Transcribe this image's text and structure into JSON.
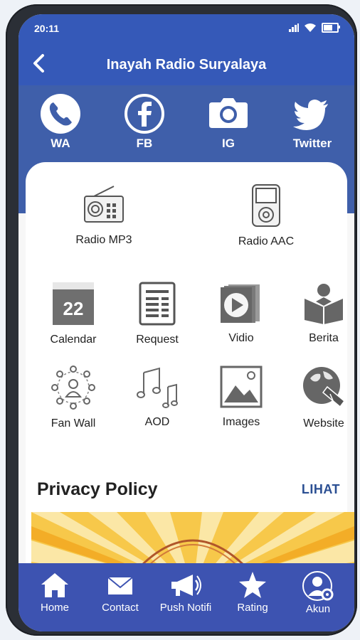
{
  "status": {
    "time": "20:11"
  },
  "app": {
    "title": "Inayah Radio Suryalaya"
  },
  "social": [
    {
      "label": "WA",
      "icon": "phone-icon"
    },
    {
      "label": "FB",
      "icon": "facebook-icon"
    },
    {
      "label": "IG",
      "icon": "camera-icon"
    },
    {
      "label": "Twitter",
      "icon": "twitter-icon"
    }
  ],
  "radios": [
    {
      "label": "Radio MP3",
      "icon": "radio-icon"
    },
    {
      "label": "Radio AAC",
      "icon": "ipod-icon"
    }
  ],
  "menu": [
    {
      "label": "Calendar",
      "icon": "calendar-icon",
      "badge": "22"
    },
    {
      "label": "Request",
      "icon": "document-icon"
    },
    {
      "label": "Vidio",
      "icon": "video-icon"
    },
    {
      "label": "Berita",
      "icon": "reader-icon"
    },
    {
      "label": "Fan Wall",
      "icon": "network-icon"
    },
    {
      "label": "AOD",
      "icon": "music-icon"
    },
    {
      "label": "Images",
      "icon": "image-icon"
    },
    {
      "label": "Website",
      "icon": "globe-hand-icon"
    }
  ],
  "privacy": {
    "title": "Privacy Policy",
    "link": "LIHAT"
  },
  "nav": [
    {
      "label": "Home",
      "icon": "home-icon"
    },
    {
      "label": "Contact",
      "icon": "mail-icon"
    },
    {
      "label": "Push Notifi",
      "icon": "megaphone-icon"
    },
    {
      "label": "Rating",
      "icon": "star-icon"
    },
    {
      "label": "Akun",
      "icon": "account-icon"
    }
  ],
  "colors": {
    "primary": "#3559b8",
    "nav": "#3d53b1",
    "link": "#2b4f93"
  }
}
